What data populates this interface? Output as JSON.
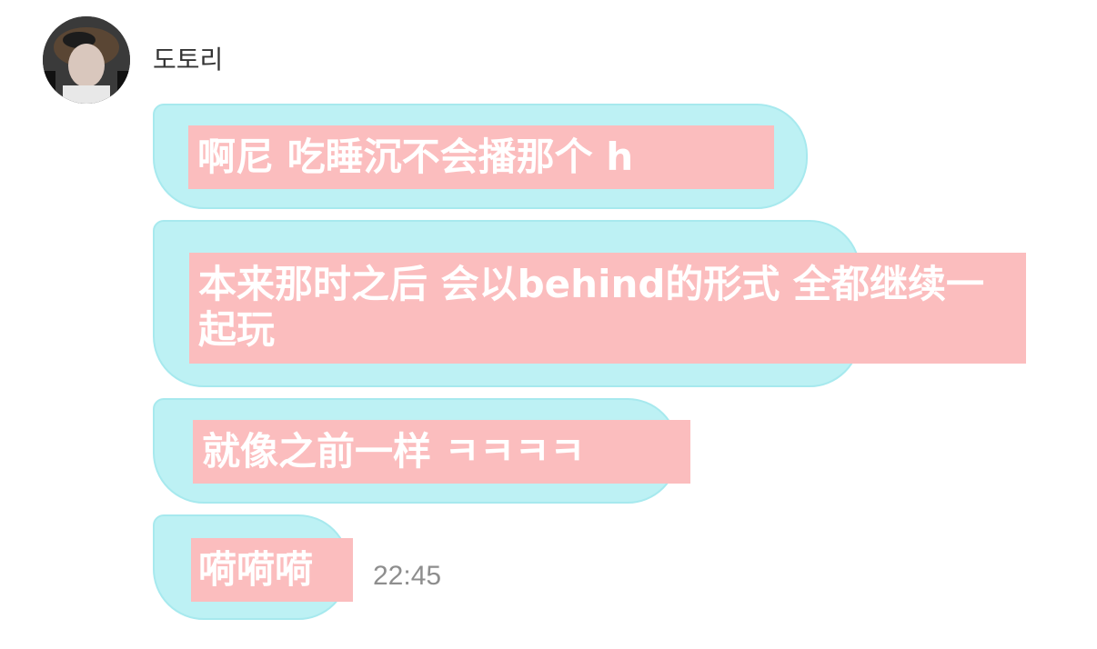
{
  "sender": {
    "name": "도토리"
  },
  "messages": [
    {
      "text": "啊尼 吃睡沉不会播那个 h"
    },
    {
      "text": "本来那时之后 会以behind的形式 全都继续一起玩"
    },
    {
      "text": "就像之前一样 ㅋㅋㅋㅋ"
    },
    {
      "text": "嗬嗬嗬"
    }
  ],
  "timestamp": "22:45",
  "colors": {
    "bubble_fill": "#bdf1f4",
    "bubble_border": "#a7e9ee",
    "text_highlight": "#fbbdbe",
    "message_text": "#ffffff",
    "timestamp_text": "#8e8e8e"
  }
}
